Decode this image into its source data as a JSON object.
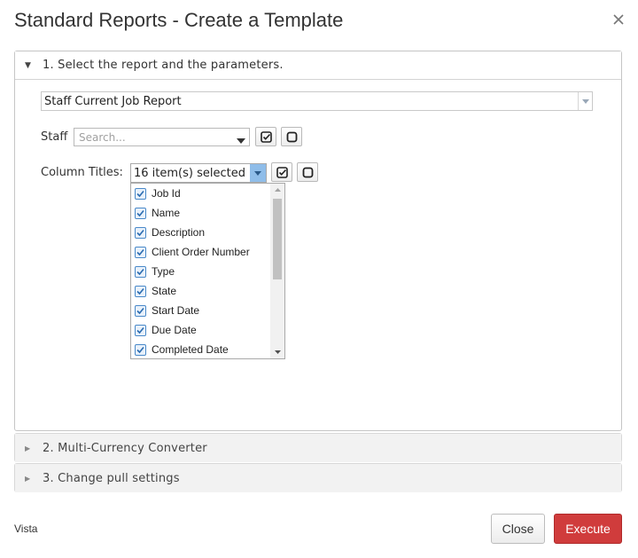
{
  "dialog": {
    "title": "Standard Reports - Create a Template"
  },
  "sections": [
    {
      "label": "1. Select the report and the parameters.",
      "expanded": true
    },
    {
      "label": "2. Multi-Currency Converter",
      "expanded": false
    },
    {
      "label": "3. Change pull settings",
      "expanded": false
    }
  ],
  "report": {
    "selected": "Staff Current Job Report"
  },
  "staff": {
    "label": "Staff",
    "placeholder": "Search..."
  },
  "columns": {
    "label": "Column Titles:",
    "summary": "16 item(s) selected",
    "items": [
      {
        "label": "Job Id",
        "checked": true
      },
      {
        "label": "Name",
        "checked": true
      },
      {
        "label": "Description",
        "checked": true
      },
      {
        "label": "Client Order Number",
        "checked": true
      },
      {
        "label": "Type",
        "checked": true
      },
      {
        "label": "State",
        "checked": true
      },
      {
        "label": "Start Date",
        "checked": true
      },
      {
        "label": "Due Date",
        "checked": true
      },
      {
        "label": "Completed Date",
        "checked": true
      }
    ]
  },
  "footer": {
    "label": "Vista",
    "close_label": "Close",
    "execute_label": "Execute"
  },
  "colors": {
    "execute": "#d03c3c",
    "dropdown_active": "#8fbde9",
    "checkbox_border": "#4a89c9"
  }
}
